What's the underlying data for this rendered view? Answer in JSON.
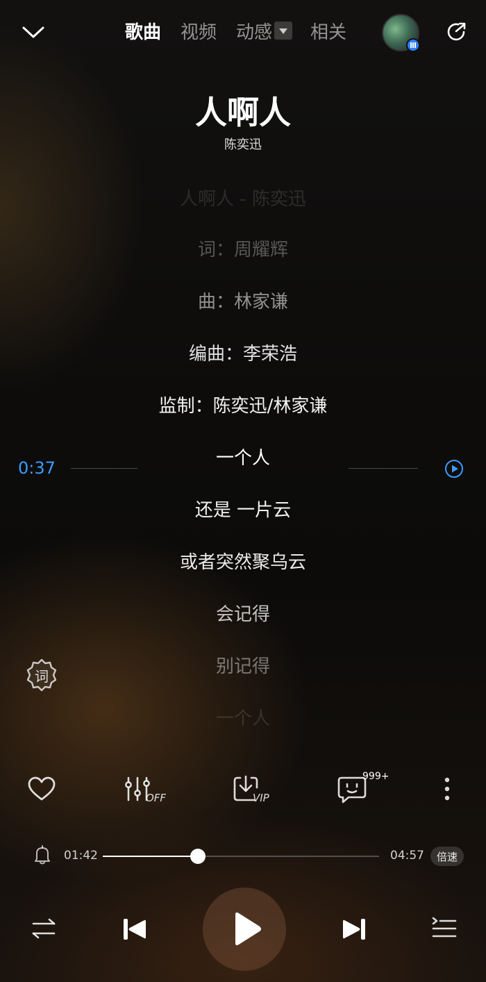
{
  "top_tabs": [
    {
      "label": "歌曲",
      "active": true
    },
    {
      "label": "视频",
      "active": false
    },
    {
      "label": "动感",
      "active": false
    },
    {
      "label": "相关",
      "active": false
    }
  ],
  "song": {
    "title": "人啊人",
    "artist": "陈奕迅"
  },
  "lyrics": [
    {
      "text": "人啊人 - 陈奕迅",
      "opacity": 0.12
    },
    {
      "text": "词：周耀辉",
      "opacity": 0.3
    },
    {
      "text": "曲：林家谦",
      "opacity": 0.55
    },
    {
      "text": "编曲：李荣浩",
      "opacity": 0.88
    },
    {
      "text": "监制：陈奕迅/林家谦",
      "opacity": 0.95
    },
    {
      "text": "一个人",
      "opacity": 1
    },
    {
      "text": "还是 一片云",
      "opacity": 0.95
    },
    {
      "text": "或者突然聚乌云",
      "opacity": 0.92
    },
    {
      "text": "会记得",
      "opacity": 0.75
    },
    {
      "text": "别记得",
      "opacity": 0.42
    },
    {
      "text": "一个人",
      "opacity": 0.12
    }
  ],
  "scroll_time": "0:37",
  "lyric_button": "词",
  "actions": {
    "eq_label": "OFF",
    "download_label": "VIP",
    "comment_count": "999+"
  },
  "progress": {
    "current": "01:42",
    "total": "04:57",
    "fraction": 0.3434,
    "speed_label": "倍速"
  },
  "colors": {
    "accent": "#3d9bff",
    "badge": "#2f7fff"
  },
  "icons": [
    "chevron-down-icon",
    "dropdown-arrow-icon",
    "share-icon",
    "play-circle-icon",
    "lyric-badge-icon",
    "heart-icon",
    "equalizer-icon",
    "download-icon",
    "comment-icon",
    "more-icon",
    "bell-icon",
    "repeat-icon",
    "previous-icon",
    "play-icon",
    "next-icon",
    "playlist-icon"
  ]
}
